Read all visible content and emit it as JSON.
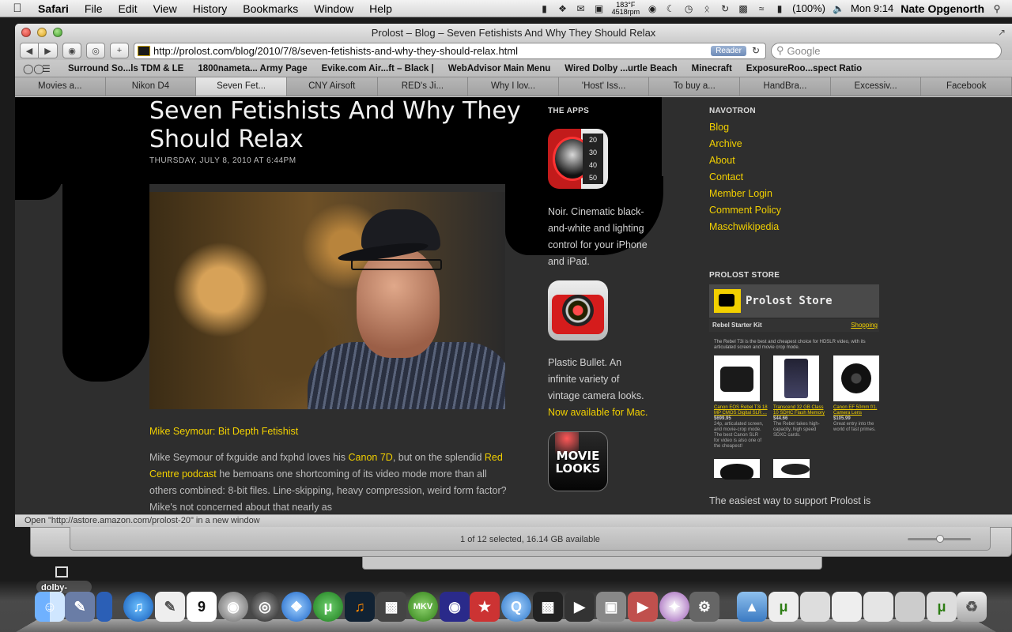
{
  "menubar": {
    "app_name": "Safari",
    "menus": [
      "File",
      "Edit",
      "View",
      "History",
      "Bookmarks",
      "Window",
      "Help"
    ],
    "temp_line1": "183°F",
    "temp_line2": "4518rpm",
    "battery": "(100%)",
    "clock": "Mon 9:14",
    "user": "Nate Opgenorth"
  },
  "window": {
    "title": "Prolost – Blog – Seven Fetishists And Why They Should Relax",
    "url": "http://prolost.com/blog/2010/7/8/seven-fetishists-and-why-they-should-relax.html",
    "reader_label": "Reader",
    "search_placeholder": "Google"
  },
  "bookmarks": [
    "Surround So...ls TDM & LE",
    "1800nameta... Army Page",
    "Evike.com Air...ft – Black |",
    "WebAdvisor Main Menu",
    "Wired Dolby ...urtle Beach",
    "Minecraft",
    "ExposureRoo...spect Ratio"
  ],
  "tabs": [
    "Movies a...",
    "Nikon D4",
    "Seven Fet...",
    "CNY Airsoft",
    "RED's Ji...",
    "Why I lov...",
    "'Host' Iss...",
    "To buy a...",
    "HandBra...",
    "Excessiv...",
    "Facebook"
  ],
  "post": {
    "title": "Seven Fetishists And Why They Should Relax",
    "date": "THURSDAY, JULY 8, 2010 AT 6:44PM",
    "subhead": "Mike Seymour: Bit Depth Fetishist",
    "body_1": "Mike Seymour of fxguide and fxphd loves his ",
    "body_link_1": "Canon 7D",
    "body_2": ", but on the splendid ",
    "body_link_2": "Red Centre podcast",
    "body_3": " he bemoans one shortcoming of its video mode more than all others combined: 8-bit files. Line-skipping, heavy compression, weird form factor? Mike's not concerned about that nearly as"
  },
  "apps": {
    "heading": "THE APPS",
    "noir_dial": [
      "20",
      "30",
      "40",
      "50"
    ],
    "noir_desc": "Noir. Cinematic black-and-white and lighting control for your iPhone and iPad.",
    "pb_desc": "Plastic Bullet. An infinite variety of vintage camera looks. ",
    "pb_link": "Now available for Mac.",
    "ml_text": "MOVIE LOOKS"
  },
  "navotron": {
    "heading": "NAVOTRON",
    "links": [
      "Blog",
      "Archive",
      "About",
      "Contact",
      "Member Login",
      "Comment Policy",
      "Maschwikipedia"
    ]
  },
  "store": {
    "heading": "PROLOST STORE",
    "banner": "Prolost Store",
    "kit": "Rebel Starter Kit",
    "shopping": "Shopping",
    "intro": "The Rebel T3i is the best and cheapest choice for HDSLR video, with its articulated screen and movie crop mode.",
    "products": [
      {
        "name": "Canon EOS Rebel T3i 18 MP CMOS Digital SLR ...",
        "price": "$699.95",
        "desc": "24p, articulated screen, and movie-crop mode. The best Canon SLR for video is also one of the cheapest!"
      },
      {
        "name": "Transcend 32 GB Class 10 SDHC Flash Memory",
        "price": "$44.66",
        "desc": "The Rebel takes high-capacity, high speed SDXC cards."
      },
      {
        "name": "Canon EF 50mm f/1. Camera Lens",
        "price": "$105.99",
        "desc": "Great entry into the world of fast primes."
      }
    ],
    "footer": "The easiest way to support Prolost is"
  },
  "statusbar": "Open \"http://astore.amazon.com/prolost-20\" in a new window",
  "finder": {
    "status": "1 of 12 selected, 16.14 GB available"
  },
  "dock": {
    "hover_label": "dolby-",
    "calendar_day": "9",
    "mkv": "MKV"
  }
}
